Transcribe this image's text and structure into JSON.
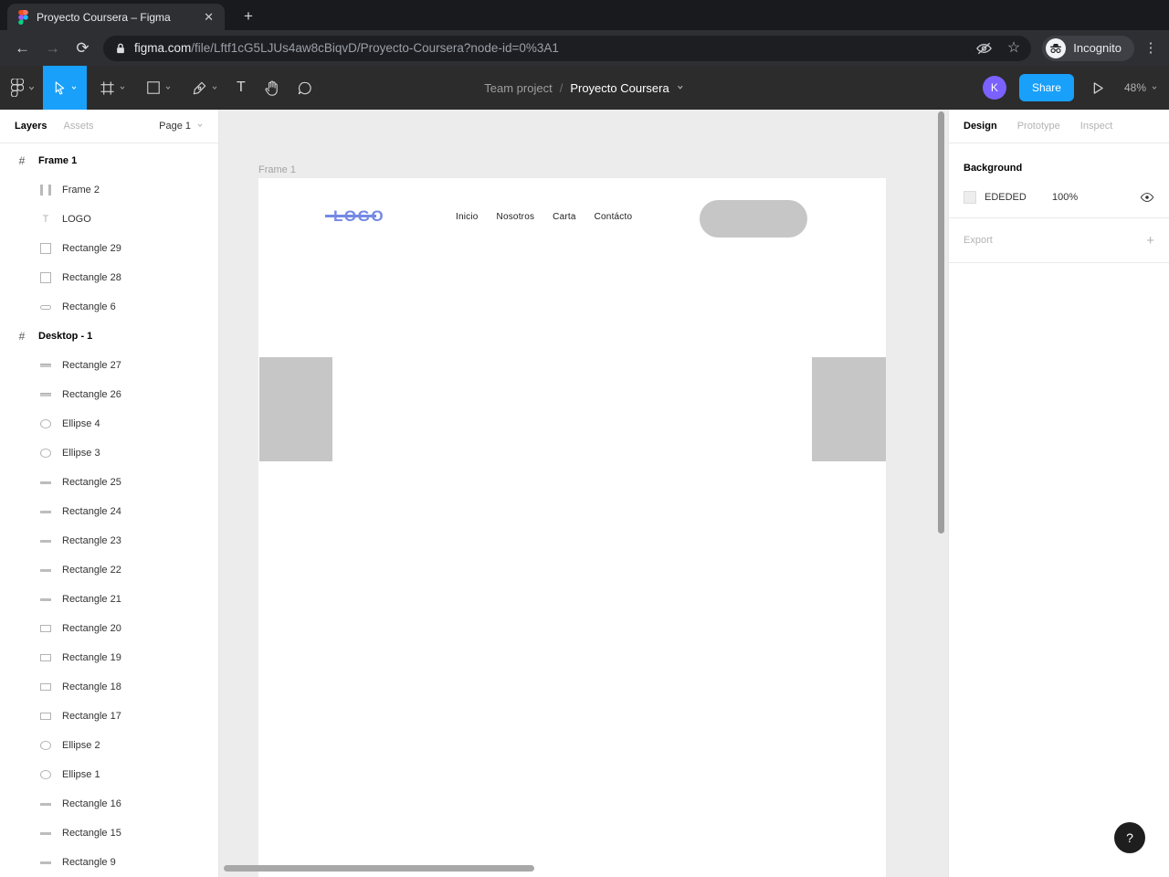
{
  "browser": {
    "tab_title": "Proyecto Coursera – Figma",
    "close_glyph": "✕",
    "new_tab_glyph": "+",
    "back_glyph": "←",
    "forward_glyph": "→",
    "reload_glyph": "⟳",
    "url_domain": "figma.com",
    "url_path": "/file/Lftf1cG5LJUs4aw8cBiqvD/Proyecto-Coursera?node-id=0%3A1",
    "star_glyph": "☆",
    "incognito_label": "Incognito",
    "menu_glyph": "⋮"
  },
  "figma_toolbar": {
    "breadcrumb": {
      "project": "Team project",
      "separator": "/",
      "file": "Proyecto Coursera"
    },
    "text_tool_glyph": "T",
    "avatar_initial": "K",
    "share_label": "Share",
    "zoom_level": "48%",
    "accent_color": "#18a0fb"
  },
  "layers_panel": {
    "tabs": [
      {
        "label": "Layers"
      },
      {
        "label": "Assets"
      }
    ],
    "page_selector": "Page 1",
    "layers": [
      {
        "name": "Frame 1",
        "icon": "frame",
        "indent": 1,
        "bold": true
      },
      {
        "name": "Frame 2",
        "icon": "frame2",
        "indent": 2,
        "bold": false
      },
      {
        "name": "LOGO",
        "icon": "text",
        "indent": 2,
        "bold": false
      },
      {
        "name": "Rectangle 29",
        "icon": "rect-tall",
        "indent": 2,
        "bold": false
      },
      {
        "name": "Rectangle 28",
        "icon": "rect-tall",
        "indent": 2,
        "bold": false
      },
      {
        "name": "Rectangle 6",
        "icon": "pill",
        "indent": 2,
        "bold": false
      },
      {
        "name": "Desktop - 1",
        "icon": "frame",
        "indent": 1,
        "bold": true
      },
      {
        "name": "Rectangle 27",
        "icon": "bar-thick",
        "indent": 2,
        "bold": false
      },
      {
        "name": "Rectangle 26",
        "icon": "bar-thick",
        "indent": 2,
        "bold": false
      },
      {
        "name": "Ellipse 4",
        "icon": "ellipse",
        "indent": 2,
        "bold": false
      },
      {
        "name": "Ellipse 3",
        "icon": "ellipse",
        "indent": 2,
        "bold": false
      },
      {
        "name": "Rectangle 25",
        "icon": "bar-thin",
        "indent": 2,
        "bold": false
      },
      {
        "name": "Rectangle 24",
        "icon": "bar-thin",
        "indent": 2,
        "bold": false
      },
      {
        "name": "Rectangle 23",
        "icon": "bar-thin",
        "indent": 2,
        "bold": false
      },
      {
        "name": "Rectangle 22",
        "icon": "bar-thin",
        "indent": 2,
        "bold": false
      },
      {
        "name": "Rectangle 21",
        "icon": "bar-thin",
        "indent": 2,
        "bold": false
      },
      {
        "name": "Rectangle 20",
        "icon": "rect-wide",
        "indent": 2,
        "bold": false
      },
      {
        "name": "Rectangle 19",
        "icon": "rect-wide",
        "indent": 2,
        "bold": false
      },
      {
        "name": "Rectangle 18",
        "icon": "rect-wide",
        "indent": 2,
        "bold": false
      },
      {
        "name": "Rectangle 17",
        "icon": "rect-wide",
        "indent": 2,
        "bold": false
      },
      {
        "name": "Ellipse 2",
        "icon": "ellipse",
        "indent": 2,
        "bold": false
      },
      {
        "name": "Ellipse 1",
        "icon": "ellipse",
        "indent": 2,
        "bold": false
      },
      {
        "name": "Rectangle 16",
        "icon": "bar-thin",
        "indent": 2,
        "bold": false
      },
      {
        "name": "Rectangle 15",
        "icon": "bar-thin",
        "indent": 2,
        "bold": false
      },
      {
        "name": "Rectangle 9",
        "icon": "bar-thin",
        "indent": 2,
        "bold": false
      }
    ]
  },
  "canvas": {
    "frame_label": "Frame 1",
    "design": {
      "logo_text": "LOGO",
      "logo_color": "#7488e5",
      "nav_items": [
        "Inicio",
        "Nosotros",
        "Carta",
        "Contácto"
      ],
      "placeholder_color": "#c6c6c6"
    }
  },
  "inspector": {
    "tabs": [
      {
        "label": "Design"
      },
      {
        "label": "Prototype"
      },
      {
        "label": "Inspect"
      }
    ],
    "background": {
      "title": "Background",
      "hex": "EDEDED",
      "opacity": "100%"
    },
    "export": {
      "title": "Export",
      "add_glyph": "+"
    }
  },
  "help": {
    "label": "?"
  }
}
